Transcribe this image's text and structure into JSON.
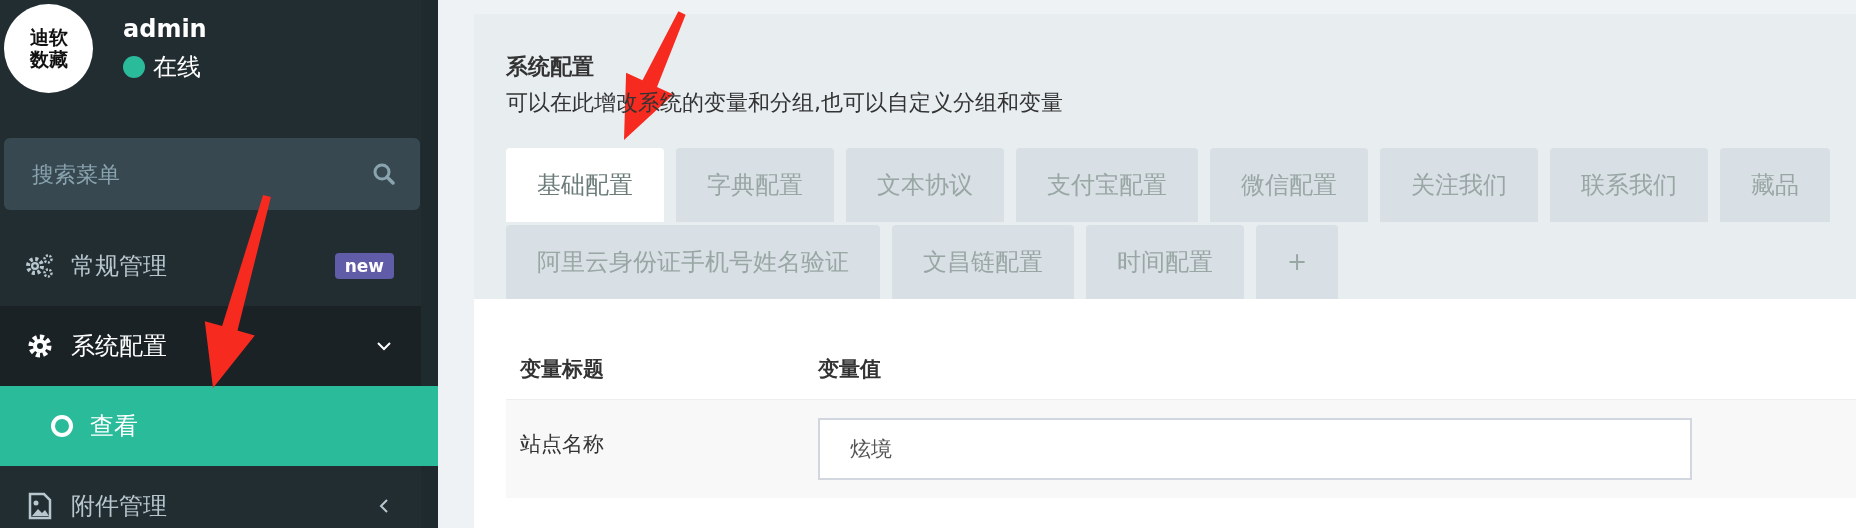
{
  "user": {
    "logo_lines": [
      "迪软",
      "数藏"
    ],
    "name": "admin",
    "status": "在线"
  },
  "search": {
    "placeholder": "搜索菜单"
  },
  "menu": [
    {
      "label": "常规管理",
      "badge": "new",
      "expanded": false
    },
    {
      "label": "系统配置",
      "expanded": true,
      "children": [
        {
          "label": "查看",
          "selected": true
        }
      ]
    },
    {
      "label": "附件管理",
      "expanded": false
    }
  ],
  "page": {
    "title": "系统配置",
    "description": "可以在此增改系统的变量和分组,也可以自定义分组和变量"
  },
  "tab_rows": [
    [
      {
        "label": "基础配置",
        "selected": true
      },
      {
        "label": "字典配置",
        "selected": false
      },
      {
        "label": "文本协议",
        "selected": false
      },
      {
        "label": "支付宝配置",
        "selected": false
      },
      {
        "label": "微信配置",
        "selected": false
      },
      {
        "label": "关注我们",
        "selected": false
      },
      {
        "label": "联系我们",
        "selected": false
      },
      {
        "label": "藏品",
        "selected": false
      }
    ],
    [
      {
        "label": "阿里云身份证手机号姓名验证",
        "selected": false
      },
      {
        "label": "文昌链配置",
        "selected": false
      },
      {
        "label": "时间配置",
        "selected": false
      },
      {
        "label": "+",
        "selected": false
      }
    ]
  ],
  "table": {
    "columns": [
      "变量标题",
      "变量值"
    ],
    "rows": [
      {
        "title": "站点名称",
        "value": "炫境"
      }
    ]
  }
}
